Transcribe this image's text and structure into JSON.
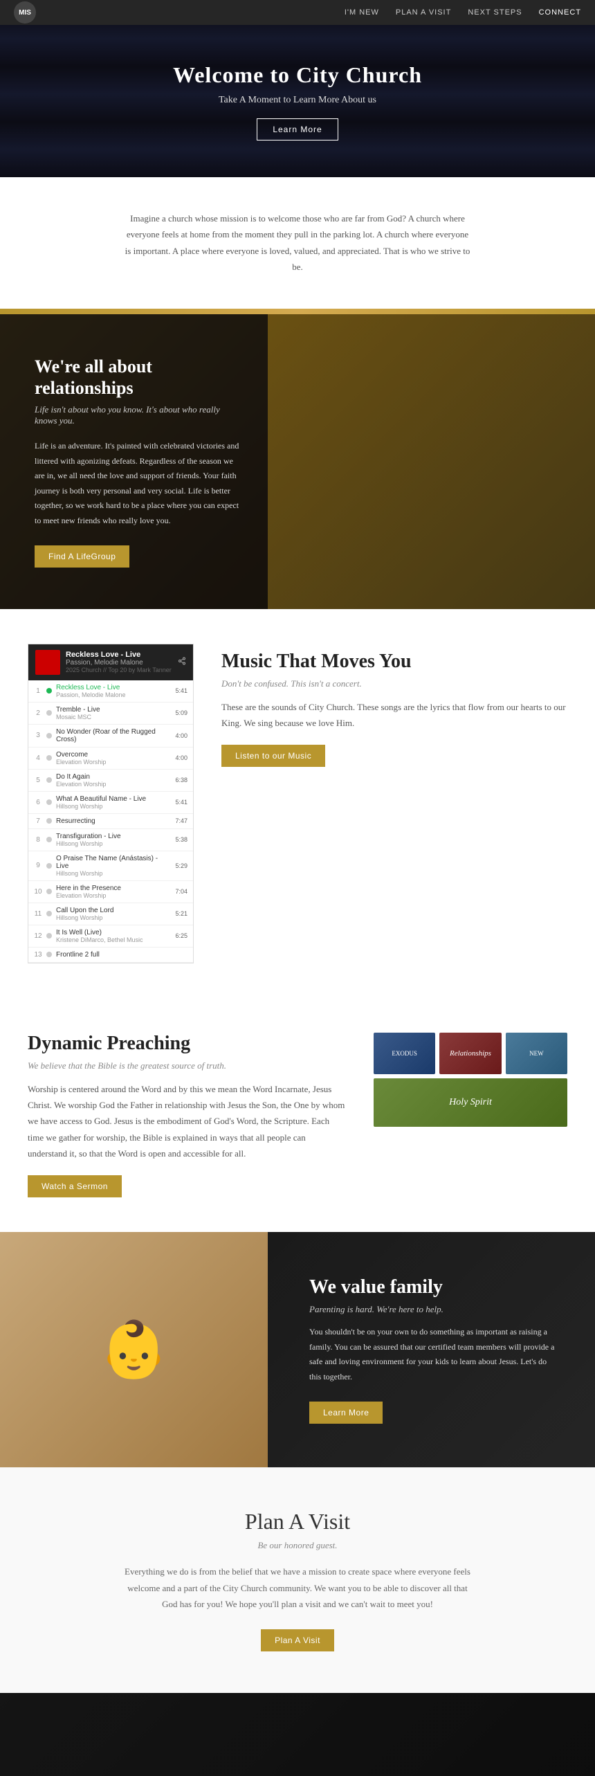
{
  "nav": {
    "logo_text": "MIS",
    "links": [
      {
        "label": "I'M NEW",
        "name": "im-new"
      },
      {
        "label": "PLAN A VISIT",
        "name": "plan-a-visit-nav"
      },
      {
        "label": "NEXT STEPS",
        "name": "next-steps"
      },
      {
        "label": "CONNECT",
        "name": "connect"
      }
    ]
  },
  "hero": {
    "title": "Welcome to City Church",
    "subtitle": "Take A Moment to Learn More About us",
    "button": "Learn More"
  },
  "intro": {
    "text": "Imagine a church whose mission is to welcome those who are far from God? A church where everyone feels at home from the moment they pull in the parking lot. A church where everyone is important. A place where everyone is loved, valued, and appreciated. That is who we strive to be."
  },
  "relationships": {
    "title": "We're all about relationships",
    "subtitle": "Life isn't about who you know. It's about who really knows you.",
    "text": "Life is an adventure. It's painted with celebrated victories and littered with agonizing defeats. Regardless of the season we are in, we all need the love and support of friends. Your faith journey is both very personal and very social. Life is better together, so we work hard to be a place where you can expect to meet new friends who really love you.",
    "button": "Find A LifeGroup"
  },
  "music": {
    "title": "Music That Moves You",
    "subtitle": "Don't be confused. This isn't a concert.",
    "text": "These are the sounds of City Church. These songs are the lyrics that flow from our hearts to our King. We sing because we love Him.",
    "button": "Listen to our Music",
    "player": {
      "now_playing": "Reckless Love - Live",
      "artist": "Passion, Melodie Malone",
      "meta": "2025 Church // Top 20 by Mark Tanner",
      "tracks": [
        {
          "num": "1",
          "name": "Reckless Love - Live",
          "artist": "Passion, Melodie Malone",
          "time": "5:41"
        },
        {
          "num": "2",
          "name": "Tremble - Live",
          "artist": "Mosaic MSC",
          "time": "5:09"
        },
        {
          "num": "3",
          "name": "No Wonder (Roar of the Rugged Cross)",
          "artist": "Elevation Worship",
          "time": "4:00"
        },
        {
          "num": "4",
          "name": "Overcome",
          "artist": "Elevation Worship",
          "time": "4:00"
        },
        {
          "num": "5",
          "name": "Do It Again",
          "artist": "Elevation Worship",
          "time": "6:38"
        },
        {
          "num": "6",
          "name": "What A Beautiful Name - Live",
          "artist": "Hillsong Worship",
          "time": "5:41"
        },
        {
          "num": "7",
          "name": "Resurrecting",
          "artist": "",
          "time": "7:47"
        },
        {
          "num": "8",
          "name": "Transfiguration - Live",
          "artist": "Hillsong Worship",
          "time": "5:38"
        },
        {
          "num": "9",
          "name": "O Praise The Name (Anástasis) - Live",
          "artist": "Hillsong Worship",
          "time": "5:29"
        },
        {
          "num": "10",
          "name": "Here in the Presence",
          "artist": "Elevation Worship",
          "time": "7:04"
        },
        {
          "num": "11",
          "name": "Call Upon the Lord",
          "artist": "Hillsong Worship",
          "time": "5:21"
        },
        {
          "num": "12",
          "name": "It Is Well (Live)",
          "artist": "Kristene DiMarco, Bethel Music",
          "time": "6:25"
        },
        {
          "num": "13",
          "name": "Frontline 2 full",
          "artist": "",
          "time": ""
        }
      ]
    }
  },
  "preaching": {
    "title": "Dynamic Preaching",
    "subtitle": "We believe that the Bible is the greatest source of truth.",
    "text": "Worship is centered around the Word and by this we mean the Word Incarnate, Jesus Christ. We worship God the Father in relationship with Jesus the Son, the One by whom we have access to God. Jesus is the embodiment of God's Word, the Scripture. Each time we gather for worship, the Bible is explained in ways that all people can understand it, so that the Word is open and accessible for all.",
    "button": "Watch a Sermon",
    "sermons": [
      {
        "label": "EXODUS",
        "class": "exodus"
      },
      {
        "label": "Relationships",
        "class": "relationships-2"
      },
      {
        "label": "NEW",
        "class": "new"
      },
      {
        "label": "Holy Spirit",
        "class": "holy"
      }
    ]
  },
  "family": {
    "title": "We value family",
    "subtitle": "Parenting is hard. We're here to help.",
    "text": "You shouldn't be on your own to do something as important as raising a family. You can be assured that our certified team members will provide a safe and loving environment for your kids to learn about Jesus. Let's do this together.",
    "button": "Learn More"
  },
  "plan": {
    "title": "Plan A Visit",
    "subtitle": "Be our honored guest.",
    "text": "Everything we do is from the belief that we have a mission to create space where everyone feels welcome and a part of the City Church community. We want you to be able to discover all that God has for you! We hope you'll plan a visit and we can't wait to meet you!",
    "button": "Plan A Visit"
  }
}
